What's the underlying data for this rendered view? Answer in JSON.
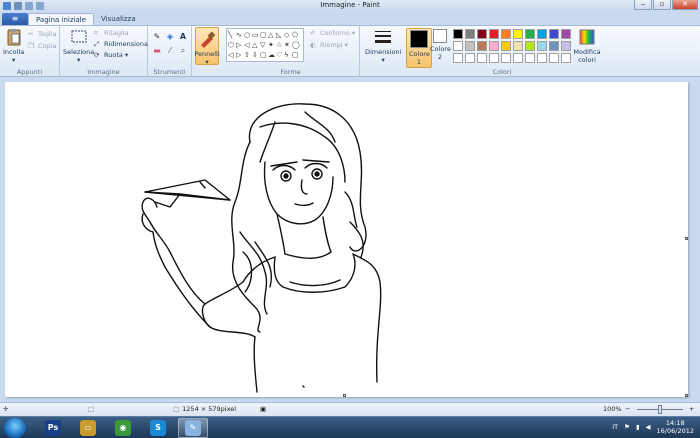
{
  "window": {
    "title": "Immagine - Paint"
  },
  "tabs": [
    {
      "label": "Pagina iniziale",
      "active": true
    },
    {
      "label": "Visualizza",
      "active": false
    }
  ],
  "ribbon": {
    "appunti": {
      "label": "Appunti",
      "paste": "Incolla",
      "cut": "Taglia",
      "copy": "Copia"
    },
    "immagine": {
      "label": "Immagine",
      "select": "Seleziona",
      "crop": "Ritaglia",
      "resize": "Ridimensiona",
      "rotate": "Ruota"
    },
    "strumenti": {
      "label": "Strumenti"
    },
    "pennelli": {
      "label": "Pennelli"
    },
    "forme": {
      "label": "Forme",
      "outline": "Contorno",
      "fill": "Riempi",
      "shapes": [
        "╲",
        "∿",
        "○",
        "▭",
        "▢",
        "△",
        "◺",
        "◇",
        "⬠",
        "⬡",
        "▷",
        "◁",
        "△",
        "▽",
        "✦",
        "☆",
        "✶",
        "◯",
        "◁",
        "▷",
        "⇧",
        "⇩",
        "▢",
        "☁",
        "♡",
        "ϟ",
        "▢"
      ]
    },
    "dimensioni": {
      "label": "Dimensioni"
    },
    "colori": {
      "label": "Colori",
      "color1": "Colore 1",
      "color2": "Colore 2",
      "edit": "Modifica colori",
      "color1_value": "#000000",
      "color2_value": "#ffffff",
      "palette_row1": [
        "#000000",
        "#7f7f7f",
        "#880015",
        "#ed1c24",
        "#ff7f27",
        "#fff200",
        "#22b14c",
        "#00a2e8",
        "#3f48cc",
        "#a349a4"
      ],
      "palette_row2": [
        "#ffffff",
        "#c3c3c3",
        "#b97a57",
        "#ffaec9",
        "#ffc90e",
        "#efe4b0",
        "#b5e61d",
        "#99d9ea",
        "#7092be",
        "#c8bfe7"
      ],
      "palette_row3": [
        "#ffffff",
        "#ffffff",
        "#ffffff",
        "#ffffff",
        "#ffffff",
        "#ffffff",
        "#ffffff",
        "#ffffff",
        "#ffffff",
        "#ffffff"
      ]
    }
  },
  "status": {
    "dimensions": "1254 × 579pixel",
    "zoom": "100%",
    "zoom_minus": "−",
    "zoom_plus": "+",
    "zoom_fraction": 0.5
  },
  "taskbar": {
    "language": "IT",
    "time": "14:18",
    "date": "16/06/2012",
    "apps": [
      {
        "name": "Ps",
        "color": "#1a3f8a"
      },
      {
        "name": "▭",
        "color": "#c99a2e"
      },
      {
        "name": "◉",
        "color": "#3a9a3a"
      },
      {
        "name": "S",
        "color": "#1a8ad6"
      },
      {
        "name": "✎",
        "color": "#8ab4e0"
      }
    ]
  }
}
